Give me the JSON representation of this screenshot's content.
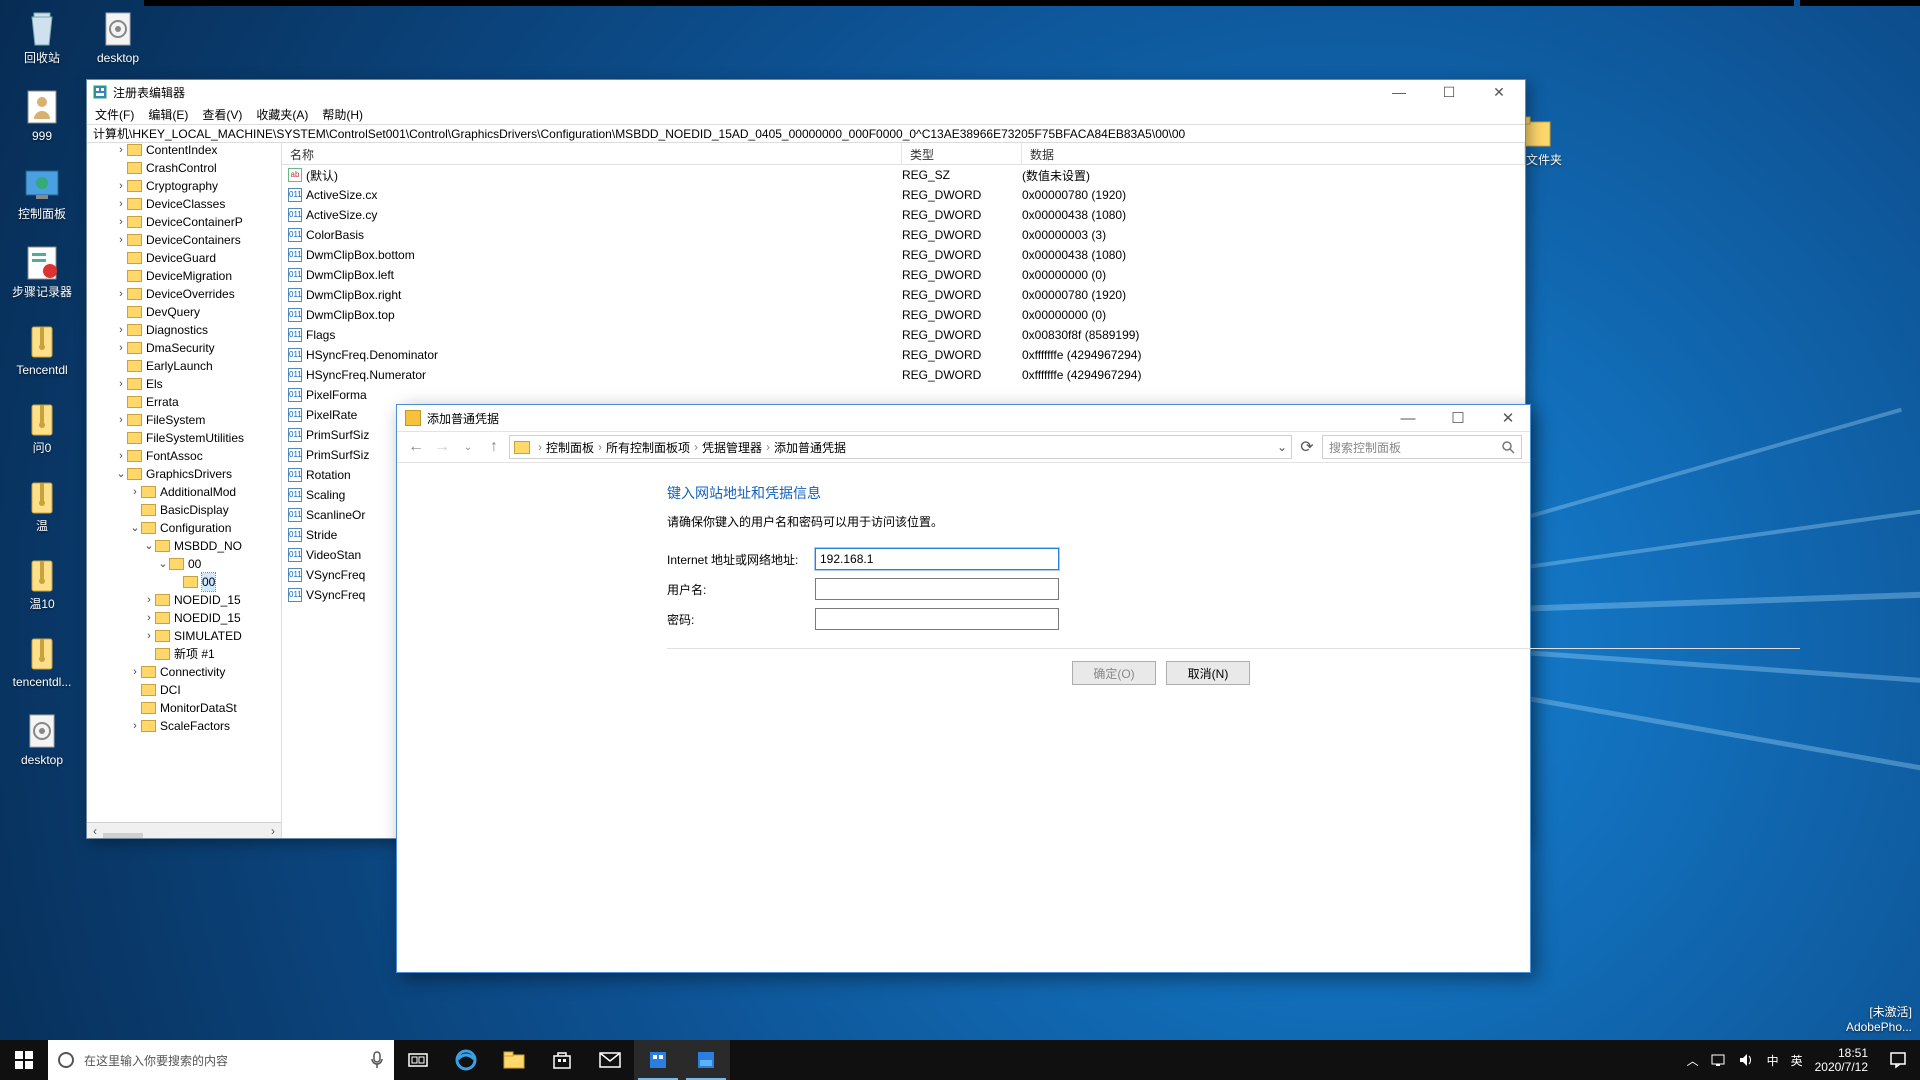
{
  "desktop": {
    "left_icons": [
      {
        "label": "回收站",
        "kind": "bin"
      },
      {
        "label": "999",
        "kind": "user"
      },
      {
        "label": "控制面板",
        "kind": "cp"
      },
      {
        "label": "步骤记录器",
        "kind": "rec"
      },
      {
        "label": "Tencentdl",
        "kind": "zip"
      },
      {
        "label": "问0",
        "kind": "zip"
      },
      {
        "label": "温",
        "kind": "zip"
      },
      {
        "label": "温10",
        "kind": "zip"
      },
      {
        "label": "tencentdl...",
        "kind": "zip"
      },
      {
        "label": "desktop",
        "kind": "ini"
      }
    ],
    "col2_icons": [
      {
        "label": "desktop",
        "kind": "ini"
      }
    ],
    "right_icons": [
      {
        "label": "新建文件夹",
        "kind": "folder"
      }
    ]
  },
  "watermark": {
    "line1": "[未激活]",
    "line2": "AdobePho..."
  },
  "regedit": {
    "title": "注册表编辑器",
    "menu": [
      "文件(F)",
      "编辑(E)",
      "查看(V)",
      "收藏夹(A)",
      "帮助(H)"
    ],
    "address": "计算机\\HKEY_LOCAL_MACHINE\\SYSTEM\\ControlSet001\\Control\\GraphicsDrivers\\Configuration\\MSBDD_NOEDID_15AD_0405_00000000_000F0000_0^C13AE38966E73205F75BFACA84EB83A5\\00\\00",
    "columns": {
      "name": "名称",
      "type": "类型",
      "data": "数据"
    },
    "tree": [
      {
        "d": 2,
        "tw": "›",
        "t": "ContentIndex"
      },
      {
        "d": 2,
        "tw": "",
        "t": "CrashControl"
      },
      {
        "d": 2,
        "tw": "›",
        "t": "Cryptography"
      },
      {
        "d": 2,
        "tw": "›",
        "t": "DeviceClasses"
      },
      {
        "d": 2,
        "tw": "›",
        "t": "DeviceContainerP"
      },
      {
        "d": 2,
        "tw": "›",
        "t": "DeviceContainers"
      },
      {
        "d": 2,
        "tw": "",
        "t": "DeviceGuard"
      },
      {
        "d": 2,
        "tw": "",
        "t": "DeviceMigration"
      },
      {
        "d": 2,
        "tw": "›",
        "t": "DeviceOverrides"
      },
      {
        "d": 2,
        "tw": "",
        "t": "DevQuery"
      },
      {
        "d": 2,
        "tw": "›",
        "t": "Diagnostics"
      },
      {
        "d": 2,
        "tw": "›",
        "t": "DmaSecurity"
      },
      {
        "d": 2,
        "tw": "",
        "t": "EarlyLaunch"
      },
      {
        "d": 2,
        "tw": "›",
        "t": "Els"
      },
      {
        "d": 2,
        "tw": "",
        "t": "Errata"
      },
      {
        "d": 2,
        "tw": "›",
        "t": "FileSystem"
      },
      {
        "d": 2,
        "tw": "",
        "t": "FileSystemUtilities"
      },
      {
        "d": 2,
        "tw": "›",
        "t": "FontAssoc"
      },
      {
        "d": 2,
        "tw": "⌄",
        "t": "GraphicsDrivers"
      },
      {
        "d": 3,
        "tw": "›",
        "t": "AdditionalMod"
      },
      {
        "d": 3,
        "tw": "",
        "t": "BasicDisplay"
      },
      {
        "d": 3,
        "tw": "⌄",
        "t": "Configuration"
      },
      {
        "d": 4,
        "tw": "⌄",
        "t": "MSBDD_NO"
      },
      {
        "d": 5,
        "tw": "⌄",
        "t": "00"
      },
      {
        "d": 6,
        "tw": "",
        "t": "00",
        "sel": true
      },
      {
        "d": 4,
        "tw": "›",
        "t": "NOEDID_15"
      },
      {
        "d": 4,
        "tw": "›",
        "t": "NOEDID_15"
      },
      {
        "d": 4,
        "tw": "›",
        "t": "SIMULATED"
      },
      {
        "d": 4,
        "tw": "",
        "t": "新项 #1"
      },
      {
        "d": 3,
        "tw": "›",
        "t": "Connectivity"
      },
      {
        "d": 3,
        "tw": "",
        "t": "DCI"
      },
      {
        "d": 3,
        "tw": "",
        "t": "MonitorDataSt"
      },
      {
        "d": 3,
        "tw": "›",
        "t": "ScaleFactors"
      }
    ],
    "rows": [
      {
        "ico": "ab",
        "name": "(默认)",
        "type": "REG_SZ",
        "data": "(数值未设置)"
      },
      {
        "ico": "dw",
        "name": "ActiveSize.cx",
        "type": "REG_DWORD",
        "data": "0x00000780 (1920)"
      },
      {
        "ico": "dw",
        "name": "ActiveSize.cy",
        "type": "REG_DWORD",
        "data": "0x00000438 (1080)"
      },
      {
        "ico": "dw",
        "name": "ColorBasis",
        "type": "REG_DWORD",
        "data": "0x00000003 (3)"
      },
      {
        "ico": "dw",
        "name": "DwmClipBox.bottom",
        "type": "REG_DWORD",
        "data": "0x00000438 (1080)"
      },
      {
        "ico": "dw",
        "name": "DwmClipBox.left",
        "type": "REG_DWORD",
        "data": "0x00000000 (0)"
      },
      {
        "ico": "dw",
        "name": "DwmClipBox.right",
        "type": "REG_DWORD",
        "data": "0x00000780 (1920)"
      },
      {
        "ico": "dw",
        "name": "DwmClipBox.top",
        "type": "REG_DWORD",
        "data": "0x00000000 (0)"
      },
      {
        "ico": "dw",
        "name": "Flags",
        "type": "REG_DWORD",
        "data": "0x00830f8f (8589199)"
      },
      {
        "ico": "dw",
        "name": "HSyncFreq.Denominator",
        "type": "REG_DWORD",
        "data": "0xfffffffe (4294967294)"
      },
      {
        "ico": "dw",
        "name": "HSyncFreq.Numerator",
        "type": "REG_DWORD",
        "data": "0xfffffffe (4294967294)"
      },
      {
        "ico": "dw",
        "name": "PixelForma",
        "type": "",
        "": ""
      },
      {
        "ico": "dw",
        "name": "PixelRate",
        "type": "",
        "data": ""
      },
      {
        "ico": "dw",
        "name": "PrimSurfSiz",
        "type": "",
        "data": ""
      },
      {
        "ico": "dw",
        "name": "PrimSurfSiz",
        "type": "",
        "data": ""
      },
      {
        "ico": "dw",
        "name": "Rotation",
        "type": "",
        "data": ""
      },
      {
        "ico": "dw",
        "name": "Scaling",
        "type": "",
        "data": ""
      },
      {
        "ico": "dw",
        "name": "ScanlineOr",
        "type": "",
        "data": ""
      },
      {
        "ico": "dw",
        "name": "Stride",
        "type": "",
        "data": ""
      },
      {
        "ico": "dw",
        "name": "VideoStan",
        "type": "",
        "data": ""
      },
      {
        "ico": "dw",
        "name": "VSyncFreq",
        "type": "",
        "data": ""
      },
      {
        "ico": "dw",
        "name": "VSyncFreq",
        "type": "",
        "data": ""
      }
    ]
  },
  "dialog": {
    "title": "添加普通凭据",
    "breadcrumb": [
      "控制面板",
      "所有控制面板项",
      "凭据管理器",
      "添加普通凭据"
    ],
    "search_placeholder": "搜索控制面板",
    "heading": "键入网站地址和凭据信息",
    "sub": "请确保你键入的用户名和密码可以用于访问该位置。",
    "fields": {
      "addr_label": "Internet 地址或网络地址:",
      "addr_value": "192.168.1",
      "user_label": "用户名:",
      "user_value": "",
      "pass_label": "密码:",
      "pass_value": ""
    },
    "ok": "确定(O)",
    "cancel": "取消(N)"
  },
  "taskbar": {
    "search_placeholder": "在这里输入你要搜索的内容",
    "ime_lang": "中",
    "ime_sub": "英",
    "time": "18:51",
    "date": "2020/7/12"
  }
}
